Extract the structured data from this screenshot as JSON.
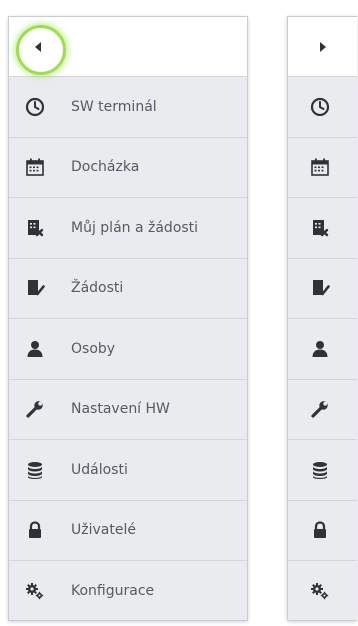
{
  "menu": {
    "toggle_expanded": "collapse-menu",
    "toggle_collapsed": "expand-menu",
    "items": [
      {
        "label": "SW terminál",
        "icon": "clock-icon"
      },
      {
        "label": "Docházka",
        "icon": "calendar-icon"
      },
      {
        "label": "Můj plán a žádosti",
        "icon": "plan-requests-icon"
      },
      {
        "label": "Žádosti",
        "icon": "requests-icon"
      },
      {
        "label": "Osoby",
        "icon": "person-icon"
      },
      {
        "label": "Nastavení HW",
        "icon": "wrench-icon"
      },
      {
        "label": "Události",
        "icon": "database-icon"
      },
      {
        "label": "Uživatelé",
        "icon": "lock-icon"
      },
      {
        "label": "Konfigurace",
        "icon": "gears-icon"
      }
    ]
  },
  "colors": {
    "panel_bg": "#e9ebee",
    "icon": "#2f3337",
    "text": "#555b61",
    "highlight": "#9be04a"
  }
}
